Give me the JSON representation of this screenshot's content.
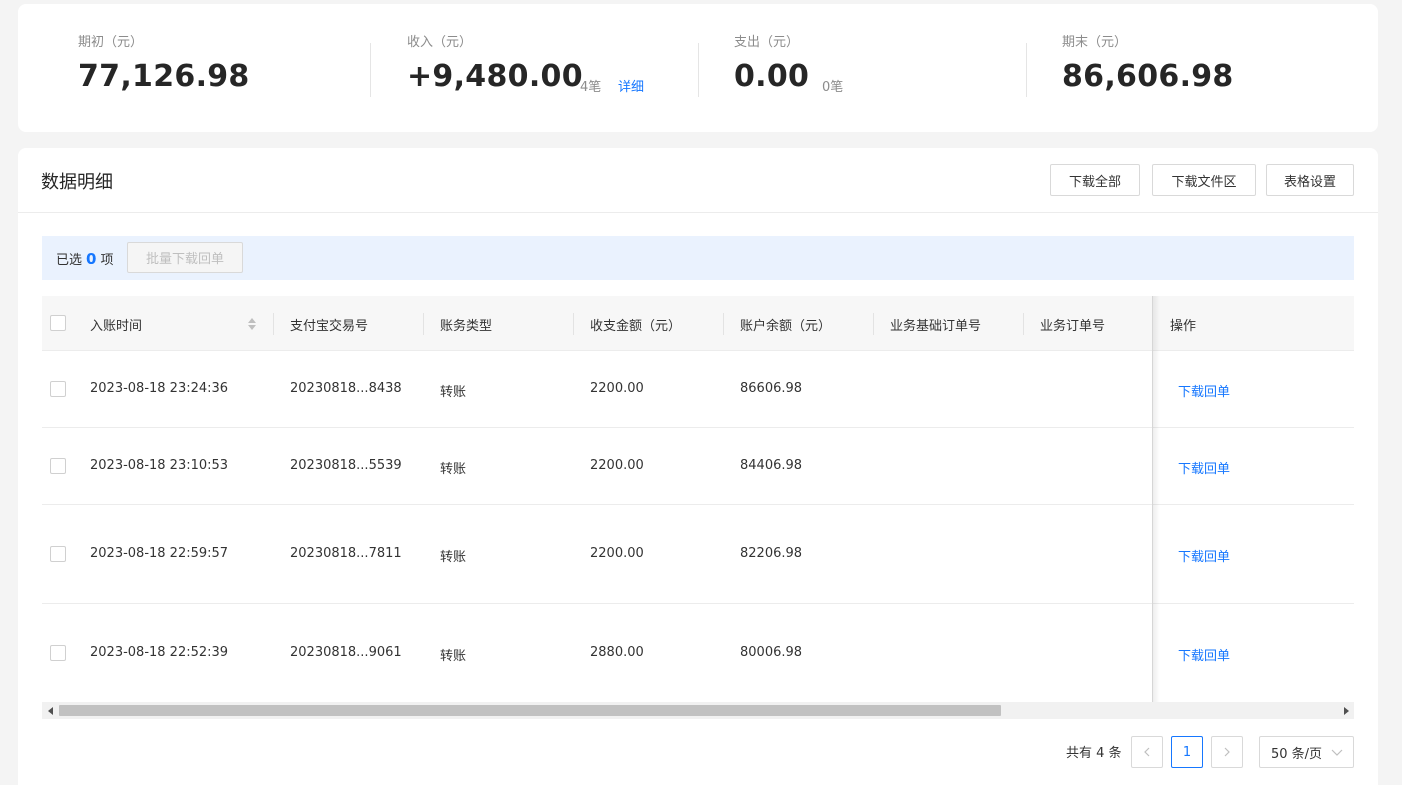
{
  "summary": {
    "opening": {
      "label": "期初（元）",
      "value": "77,126.98"
    },
    "income": {
      "label": "收入（元）",
      "value": "+9,480.00",
      "count": "4笔",
      "detail_link": "详细"
    },
    "expense": {
      "label": "支出（元）",
      "value": "0.00",
      "count": "0笔"
    },
    "closing": {
      "label": "期末（元）",
      "value": "86,606.98"
    }
  },
  "detail": {
    "title": "数据明细",
    "buttons": {
      "download_all": "下载全部",
      "download_area": "下载文件区",
      "table_settings": "表格设置"
    }
  },
  "selection": {
    "prefix": "已选",
    "count": "0",
    "suffix": "项",
    "batch_button": "批量下载回单"
  },
  "table": {
    "headers": {
      "time": "入账时间",
      "trade_no": "支付宝交易号",
      "type": "账务类型",
      "amount": "收支金额（元）",
      "balance": "账户余额（元）",
      "base_order": "业务基础订单号",
      "order": "业务订单号",
      "action": "操作"
    },
    "rows": [
      {
        "time": "2023-08-18 23:24:36",
        "trade_no": "20230818...8438",
        "type": "转账",
        "amount": "2200.00",
        "balance": "86606.98",
        "base_order": "",
        "order": "",
        "action": "下载回单"
      },
      {
        "time": "2023-08-18 23:10:53",
        "trade_no": "20230818...5539",
        "type": "转账",
        "amount": "2200.00",
        "balance": "84406.98",
        "base_order": "",
        "order": "",
        "action": "下载回单"
      },
      {
        "time": "2023-08-18 22:59:57",
        "trade_no": "20230818...7811",
        "type": "转账",
        "amount": "2200.00",
        "balance": "82206.98",
        "base_order": "",
        "order": "",
        "action": "下载回单"
      },
      {
        "time": "2023-08-18 22:52:39",
        "trade_no": "20230818...9061",
        "type": "转账",
        "amount": "2880.00",
        "balance": "80006.98",
        "base_order": "",
        "order": "",
        "action": "下载回单"
      }
    ]
  },
  "pagination": {
    "total": "共有 4 条",
    "current_page": "1",
    "page_size": "50 条/页"
  },
  "colors": {
    "accent": "#1677ff",
    "page_bg": "#f4f4f4",
    "select_bar_bg": "#eaf2fe"
  }
}
